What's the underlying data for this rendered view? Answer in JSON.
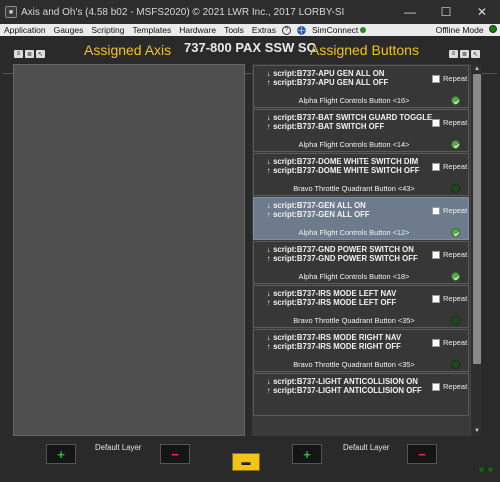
{
  "window": {
    "title": "Axis and Oh's (4.58 b02 - MSFS2020) © 2021 LWR Inc., 2017 LORBY-SI",
    "minimize": "—",
    "maximize": "☐",
    "close": "✕"
  },
  "menu": {
    "items": [
      "Application",
      "Gauges",
      "Scripting",
      "Templates",
      "Hardware",
      "Tools",
      "Extras"
    ],
    "help_icon": "?",
    "globe_icon": "🌐",
    "simconnect": "SimConnect",
    "offline": "Offline Mode"
  },
  "profile_title": "737-800 PAX SSW SC",
  "assigned_axis_title": "Assigned Axis",
  "assigned_buttons_title": "Assigned Buttons",
  "buttons": [
    {
      "down": "↓ script:B737-APU GEN ALL ON",
      "up": "↑ script:B737-APU GEN ALL OFF",
      "device": "Alpha Flight Controls Button <16>",
      "repeat_label": "Repeat",
      "state": "on",
      "selected": false
    },
    {
      "down": "↓ script:B737-BAT SWITCH GUARD TOGGLE",
      "up": "↑ script:B737-BAT SWITCH OFF",
      "device": "Alpha Flight Controls Button <14>",
      "repeat_label": "Repeat",
      "state": "on",
      "selected": false
    },
    {
      "down": "↓ script:B737-DOME WHITE SWITCH DIM",
      "up": "↑ script:B737-DOME WHITE SWITCH OFF",
      "device": "Bravo Throttle Quadrant Button <43>",
      "repeat_label": "Repeat",
      "state": "off",
      "selected": false
    },
    {
      "down": "↓ script:B737-GEN ALL ON",
      "up": "↑ script:B737-GEN ALL OFF",
      "device": "Alpha Flight Controls Button <12>",
      "repeat_label": "Repeat",
      "state": "on",
      "selected": true
    },
    {
      "down": "↓ script:B737-GND POWER SWITCH ON",
      "up": "↑ script:B737-GND POWER SWITCH OFF",
      "device": "Alpha Flight Controls Button <18>",
      "repeat_label": "Repeat",
      "state": "on",
      "selected": false
    },
    {
      "down": "↓ script:B737-IRS MODE LEFT NAV",
      "up": "↑ script:B737-IRS MODE LEFT OFF",
      "device": "Bravo Throttle Quadrant Button <35>",
      "repeat_label": "Repeat",
      "state": "off",
      "selected": false
    },
    {
      "down": "↓ script:B737-IRS MODE RIGHT NAV",
      "up": "↑ script:B737-IRS MODE RIGHT OFF",
      "device": "Bravo Throttle Quadrant Button <35>",
      "repeat_label": "Repeat",
      "state": "off",
      "selected": false
    },
    {
      "down": "↓ script:B737-LIGHT ANTICOLLISION ON",
      "up": "↑ script:B737-LIGHT ANTICOLLISION OFF",
      "device": "",
      "repeat_label": "Repeat",
      "state": "off",
      "selected": false
    }
  ],
  "bottom": {
    "plus": "+",
    "minus": "−",
    "default_layer_left": "Default Layer",
    "default_layer_right": "Default Layer",
    "center_icon": "▬"
  },
  "colors": {
    "accent_yellow": "#f0c419",
    "selected_row": "#6d7b8d",
    "add_green": "#39b54a",
    "remove_red": "#e03a3a"
  }
}
